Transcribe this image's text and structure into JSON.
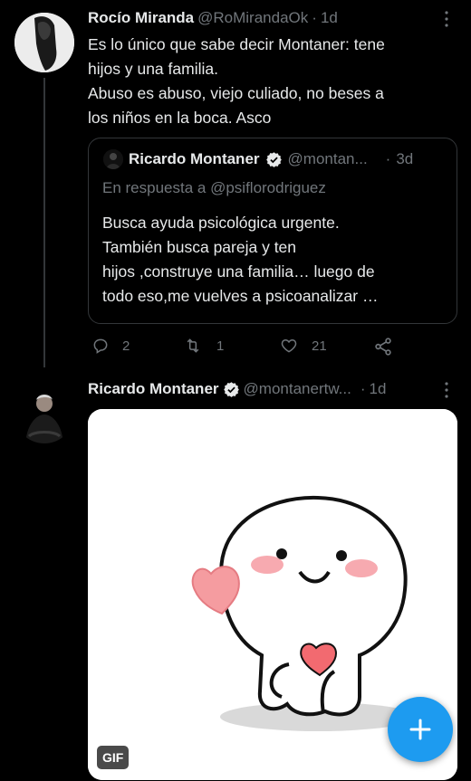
{
  "tweet1": {
    "name": "Rocío Miranda",
    "handle": "@RoMirandaOk",
    "separator": "·",
    "time": "1d",
    "text_lines": [
      "Es lo único que sabe decir Montaner: tene",
      "hijos y una familia.",
      "Abuso es abuso, viejo culiado, no beses a",
      "los niños en la boca. Asco"
    ],
    "quote": {
      "name": "Ricardo Montaner",
      "handle": "@montan...",
      "separator": "·",
      "time": "3d",
      "reply_to": "En respuesta a @psiflorodriguez",
      "text_lines": [
        "Busca ayuda psicológica urgente.",
        "También busca pareja y ten",
        "hijos ,construye una familia… luego de",
        "todo eso,me vuelves a psicoanalizar …"
      ]
    },
    "actions": {
      "replies": "2",
      "retweets": "1",
      "likes": "21"
    }
  },
  "tweet2": {
    "name": "Ricardo Montaner",
    "handle": "@montanertw...",
    "separator": "·",
    "time": "1d",
    "gif_label": "GIF"
  },
  "icons": {
    "more": "more-icon",
    "verified": "verified-badge-icon",
    "reply": "reply-icon",
    "retweet": "retweet-icon",
    "like": "heart-icon",
    "share": "share-icon",
    "compose": "plus-icon"
  },
  "colors": {
    "background": "#000000",
    "text": "#e7e9ea",
    "muted": "#71767b",
    "accent": "#1d9bf0"
  }
}
